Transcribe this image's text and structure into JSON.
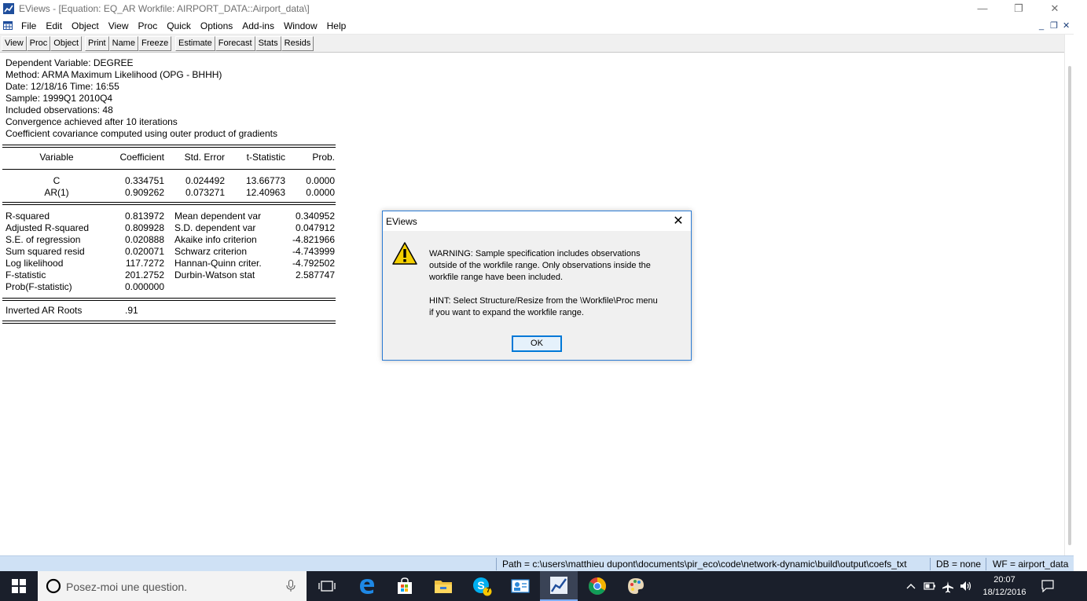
{
  "window": {
    "title": "EViews - [Equation: EQ_AR   Workfile: AIRPORT_DATA::Airport_data\\]",
    "minimize_glyph": "—",
    "restore_glyph": "❐",
    "close_glyph": "✕"
  },
  "menubar": {
    "items": [
      "File",
      "Edit",
      "Object",
      "View",
      "Proc",
      "Quick",
      "Options",
      "Add-ins",
      "Window",
      "Help"
    ],
    "mdi_minimize": "_",
    "mdi_restore": "❐",
    "mdi_close": "✕"
  },
  "toolbar": {
    "group1": [
      "View",
      "Proc",
      "Object"
    ],
    "group2": [
      "Print",
      "Name",
      "Freeze"
    ],
    "group3": [
      "Estimate",
      "Forecast",
      "Stats",
      "Resids"
    ]
  },
  "output": {
    "header_lines": [
      "Dependent Variable: DEGREE",
      "Method: ARMA Maximum Likelihood (OPG - BHHH)",
      "Date: 12/18/16   Time: 16:55",
      "Sample: 1999Q1 2010Q4",
      "Included observations: 48",
      "Convergence achieved after 10 iterations",
      "Coefficient covariance computed using outer product of gradients"
    ],
    "columns": [
      "Variable",
      "Coefficient",
      "Std. Error",
      "t-Statistic",
      "Prob."
    ],
    "coef_rows": [
      {
        "variable": "C",
        "coefficient": "0.334751",
        "std_error": "0.024492",
        "t_stat": "13.66773",
        "prob": "0.0000"
      },
      {
        "variable": "AR(1)",
        "coefficient": "0.909262",
        "std_error": "0.073271",
        "t_stat": "12.40963",
        "prob": "0.0000"
      }
    ],
    "stats_rows": [
      {
        "left_label": "R-squared",
        "left_value": "0.813972",
        "right_label": "Mean dependent var",
        "right_value": "0.340952"
      },
      {
        "left_label": "Adjusted R-squared",
        "left_value": "0.809928",
        "right_label": "S.D. dependent var",
        "right_value": "0.047912"
      },
      {
        "left_label": "S.E. of regression",
        "left_value": "0.020888",
        "right_label": "Akaike info criterion",
        "right_value": "-4.821966"
      },
      {
        "left_label": "Sum squared resid",
        "left_value": "0.020071",
        "right_label": "Schwarz criterion",
        "right_value": "-4.743999"
      },
      {
        "left_label": "Log likelihood",
        "left_value": "117.7272",
        "right_label": "Hannan-Quinn criter.",
        "right_value": "-4.792502"
      },
      {
        "left_label": "F-statistic",
        "left_value": "201.2752",
        "right_label": "Durbin-Watson stat",
        "right_value": "2.587747"
      },
      {
        "left_label": "Prob(F-statistic)",
        "left_value": "0.000000",
        "right_label": "",
        "right_value": ""
      }
    ],
    "roots_label": "Inverted AR Roots",
    "roots_value": ".91"
  },
  "dialog": {
    "title": "EViews",
    "close_glyph": "✕",
    "warning_lines": [
      "WARNING: Sample specification includes observations",
      "outside of the workfile range. Only observations inside the",
      "workfile range have been included."
    ],
    "hint_lines": [
      "HINT: Select Structure/Resize from the \\Workfile\\Proc menu",
      "if you want to expand the workfile range."
    ],
    "ok_label": "OK",
    "icon": "warning-icon"
  },
  "statusbar": {
    "path": "Path = c:\\users\\matthieu dupont\\documents\\pir_eco\\code\\network-dynamic\\build\\output\\coefs_txt",
    "db": "DB = none",
    "wf": "WF = airport_data"
  },
  "taskbar": {
    "search_placeholder": "Posez-moi une question.",
    "time": "20:07",
    "date": "18/12/2016",
    "skype_badge": "7"
  },
  "colors": {
    "statusbar": "#cfe1f5",
    "taskbar": "#1a1f2b",
    "dialog_border": "#2b7bd4",
    "warning_yellow": "#f5d000"
  }
}
